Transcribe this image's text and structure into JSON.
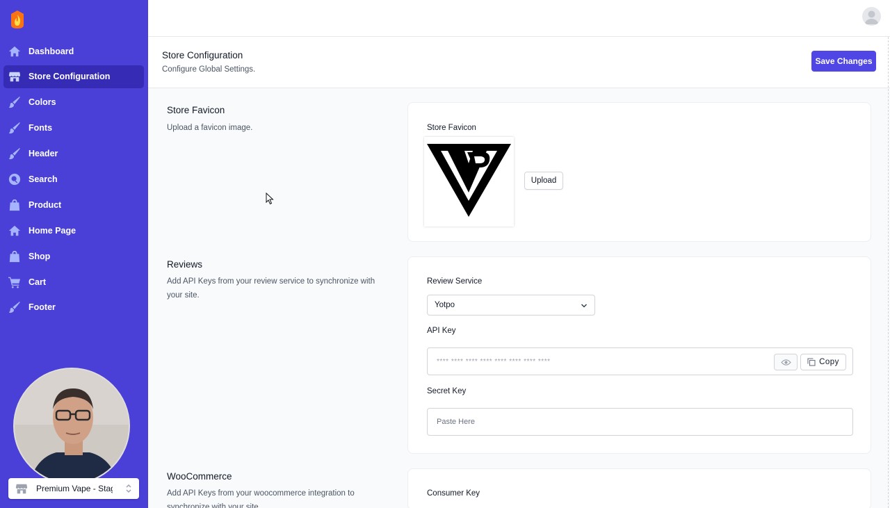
{
  "sidebar": {
    "logo_icon": "flame-logo-icon",
    "items": [
      {
        "label": "Dashboard",
        "icon": "home-icon",
        "active": false
      },
      {
        "label": "Store Configuration",
        "icon": "store-icon",
        "active": true
      },
      {
        "label": "Colors",
        "icon": "brush-icon",
        "active": false
      },
      {
        "label": "Fonts",
        "icon": "brush-icon",
        "active": false
      },
      {
        "label": "Header",
        "icon": "brush-icon",
        "active": false
      },
      {
        "label": "Search",
        "icon": "search-icon",
        "active": false
      },
      {
        "label": "Product",
        "icon": "bag-icon",
        "active": false
      },
      {
        "label": "Home Page",
        "icon": "home-icon",
        "active": false
      },
      {
        "label": "Shop",
        "icon": "bag-icon",
        "active": false
      },
      {
        "label": "Cart",
        "icon": "cart-icon",
        "active": false
      },
      {
        "label": "Footer",
        "icon": "brush-icon",
        "active": false
      }
    ],
    "store_selector": {
      "label": "Premium Vape - Stag",
      "icon": "storefront-icon"
    }
  },
  "topbar": {
    "avatar_icon": "user-avatar-icon"
  },
  "page": {
    "title": "Store Configuration",
    "subtitle": "Configure Global Settings.",
    "save_label": "Save Changes"
  },
  "sections": {
    "favicon": {
      "title": "Store Favicon",
      "description": "Upload a favicon image.",
      "field_label": "Store Favicon",
      "upload_label": "Upload"
    },
    "reviews": {
      "title": "Reviews",
      "description": "Add API Keys from your review service to synchronize with your site.",
      "service_label": "Review Service",
      "service_value": "Yotpo",
      "api_key_label": "API Key",
      "api_key_value": "**** **** **** **** **** **** **** ****",
      "copy_label": "Copy",
      "secret_key_label": "Secret Key",
      "secret_key_placeholder": "Paste Here"
    },
    "woocommerce": {
      "title": "WooCommerce",
      "description": "Add API Keys from your woocommerce integration to synchronize with your site.",
      "consumer_key_label": "Consumer Key"
    }
  },
  "colors": {
    "sidebar_bg": "#4a3fd6",
    "accent": "#4f46e5"
  }
}
